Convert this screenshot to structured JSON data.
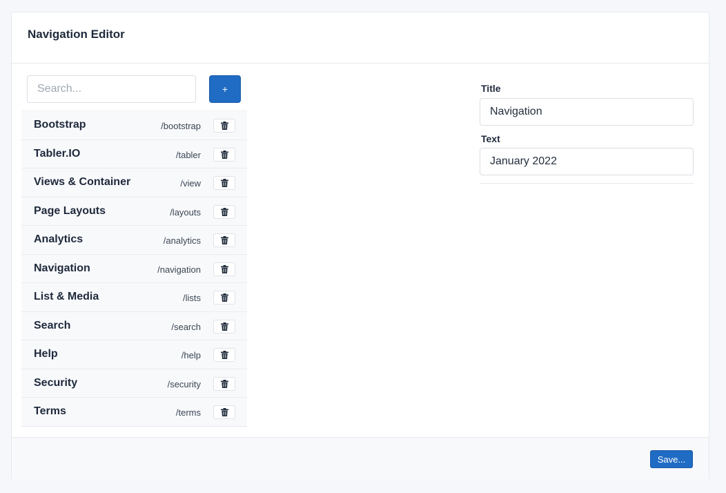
{
  "header": {
    "title": "Navigation Editor"
  },
  "search": {
    "placeholder": "Search..."
  },
  "toolbar": {
    "add_label": "+"
  },
  "nav_items": [
    {
      "label": "Bootstrap",
      "path": "/bootstrap"
    },
    {
      "label": "Tabler.IO",
      "path": "/tabler"
    },
    {
      "label": "Views & Container",
      "path": "/view"
    },
    {
      "label": "Page Layouts",
      "path": "/layouts"
    },
    {
      "label": "Analytics",
      "path": "/analytics"
    },
    {
      "label": "Navigation",
      "path": "/navigation"
    },
    {
      "label": "List & Media",
      "path": "/lists"
    },
    {
      "label": "Search",
      "path": "/search"
    },
    {
      "label": "Help",
      "path": "/help"
    },
    {
      "label": "Security",
      "path": "/security"
    },
    {
      "label": "Terms",
      "path": "/terms"
    }
  ],
  "delete_icon": "trash-icon",
  "form": {
    "title_label": "Title",
    "title_value": "Navigation",
    "text_label": "Text",
    "text_value": "January 2022"
  },
  "footer": {
    "save_label": "Save..."
  },
  "colors": {
    "primary": "#206bc4",
    "background": "#f5f7fb",
    "text": "#232e3c"
  }
}
